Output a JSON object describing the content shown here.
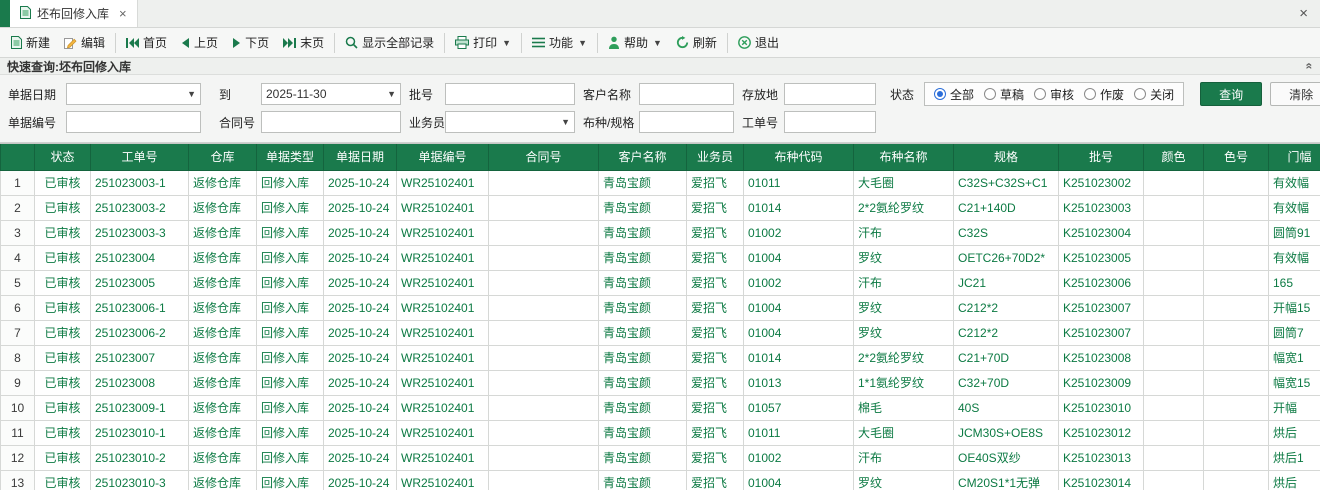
{
  "window": {
    "close_icon": "×"
  },
  "tab": {
    "label": "坯布回修入库",
    "close_icon": "×"
  },
  "toolbar": {
    "items": [
      {
        "name": "new",
        "label": "新建",
        "icon": "new-doc-icon"
      },
      {
        "name": "edit",
        "label": "编辑",
        "icon": "edit-icon"
      },
      {
        "type": "sep"
      },
      {
        "name": "first-page",
        "label": "首页",
        "icon": "first-page-icon"
      },
      {
        "name": "prev-page",
        "label": "上页",
        "icon": "prev-page-icon"
      },
      {
        "name": "next-page",
        "label": "下页",
        "icon": "next-page-icon"
      },
      {
        "name": "last-page",
        "label": "末页",
        "icon": "last-page-icon"
      },
      {
        "type": "sep"
      },
      {
        "name": "show-all-records",
        "label": "显示全部记录",
        "icon": "search-icon"
      },
      {
        "type": "sep"
      },
      {
        "name": "print",
        "label": "打印",
        "icon": "print-icon",
        "dropdown": true
      },
      {
        "type": "sep"
      },
      {
        "name": "functions",
        "label": "功能",
        "icon": "menu-icon",
        "dropdown": true
      },
      {
        "type": "sep"
      },
      {
        "name": "help",
        "label": "帮助",
        "icon": "person-icon",
        "dropdown": true
      },
      {
        "name": "refresh",
        "label": "刷新",
        "icon": "refresh-icon"
      },
      {
        "type": "sep"
      },
      {
        "name": "exit",
        "label": "退出",
        "icon": "exit-icon"
      }
    ]
  },
  "quickbar": {
    "label": "快速查询:坯布回修入库"
  },
  "filters": {
    "date_label": "单据日期",
    "date_from": "",
    "to_label": "到",
    "date_to": "2025-11-30",
    "batch_label": "批号",
    "batch_value": "",
    "customer_label": "客户名称",
    "customer_value": "",
    "location_label": "存放地",
    "location_value": "",
    "status_label": "状态",
    "status_options": [
      {
        "label": "全部",
        "selected": true
      },
      {
        "label": "草稿",
        "selected": false
      },
      {
        "label": "审核",
        "selected": false
      },
      {
        "label": "作废",
        "selected": false
      },
      {
        "label": "关闭",
        "selected": false
      }
    ],
    "query_button": "查询",
    "clear_button": "清除",
    "docno_label": "单据编号",
    "docno_value": "",
    "contract_label": "合同号",
    "contract_value": "",
    "salesman_label": "业务员",
    "salesman_value": "",
    "fabric_label": "布种/规格",
    "fabric_value": "",
    "workorder_label": "工单号",
    "workorder_value": ""
  },
  "table": {
    "columns": [
      "",
      "状态",
      "工单号",
      "仓库",
      "单据类型",
      "单据日期",
      "单据编号",
      "合同号",
      "客户名称",
      "业务员",
      "布种代码",
      "布种名称",
      "规格",
      "批号",
      "颜色",
      "色号",
      "门幅"
    ],
    "rows": [
      [
        "1",
        "已审核",
        "251023003-1",
        "返修仓库",
        "回修入库",
        "2025-10-24",
        "WR25102401",
        "",
        "青岛宝颜",
        "爱招飞",
        "01011",
        "大毛圈",
        "C32S+C32S+C1",
        "K251023002",
        "",
        "",
        "有效幅"
      ],
      [
        "2",
        "已审核",
        "251023003-2",
        "返修仓库",
        "回修入库",
        "2025-10-24",
        "WR25102401",
        "",
        "青岛宝颜",
        "爱招飞",
        "01014",
        "2*2氨纶罗纹",
        "C21+140D",
        "K251023003",
        "",
        "",
        "有效幅"
      ],
      [
        "3",
        "已审核",
        "251023003-3",
        "返修仓库",
        "回修入库",
        "2025-10-24",
        "WR25102401",
        "",
        "青岛宝颜",
        "爱招飞",
        "01002",
        "汗布",
        "C32S",
        "K251023004",
        "",
        "",
        "圆筒91"
      ],
      [
        "4",
        "已审核",
        "251023004",
        "返修仓库",
        "回修入库",
        "2025-10-24",
        "WR25102401",
        "",
        "青岛宝颜",
        "爱招飞",
        "01004",
        "罗纹",
        "OETC26+70D2*",
        "K251023005",
        "",
        "",
        "有效幅"
      ],
      [
        "5",
        "已审核",
        "251023005",
        "返修仓库",
        "回修入库",
        "2025-10-24",
        "WR25102401",
        "",
        "青岛宝颜",
        "爱招飞",
        "01002",
        "汗布",
        "JC21",
        "K251023006",
        "",
        "",
        "165"
      ],
      [
        "6",
        "已审核",
        "251023006-1",
        "返修仓库",
        "回修入库",
        "2025-10-24",
        "WR25102401",
        "",
        "青岛宝颜",
        "爱招飞",
        "01004",
        "罗纹",
        "C212*2",
        "K251023007",
        "",
        "",
        "开幅15"
      ],
      [
        "7",
        "已审核",
        "251023006-2",
        "返修仓库",
        "回修入库",
        "2025-10-24",
        "WR25102401",
        "",
        "青岛宝颜",
        "爱招飞",
        "01004",
        "罗纹",
        "C212*2",
        "K251023007",
        "",
        "",
        "圆筒7"
      ],
      [
        "8",
        "已审核",
        "251023007",
        "返修仓库",
        "回修入库",
        "2025-10-24",
        "WR25102401",
        "",
        "青岛宝颜",
        "爱招飞",
        "01014",
        "2*2氨纶罗纹",
        "C21+70D",
        "K251023008",
        "",
        "",
        "幅宽1"
      ],
      [
        "9",
        "已审核",
        "251023008",
        "返修仓库",
        "回修入库",
        "2025-10-24",
        "WR25102401",
        "",
        "青岛宝颜",
        "爱招飞",
        "01013",
        "1*1氨纶罗纹",
        "C32+70D",
        "K251023009",
        "",
        "",
        "幅宽15"
      ],
      [
        "10",
        "已审核",
        "251023009-1",
        "返修仓库",
        "回修入库",
        "2025-10-24",
        "WR25102401",
        "",
        "青岛宝颜",
        "爱招飞",
        "01057",
        "棉毛",
        "40S",
        "K251023010",
        "",
        "",
        "开幅"
      ],
      [
        "11",
        "已审核",
        "251023010-1",
        "返修仓库",
        "回修入库",
        "2025-10-24",
        "WR25102401",
        "",
        "青岛宝颜",
        "爱招飞",
        "01011",
        "大毛圈",
        "JCM30S+OE8S",
        "K251023012",
        "",
        "",
        "烘后"
      ],
      [
        "12",
        "已审核",
        "251023010-2",
        "返修仓库",
        "回修入库",
        "2025-10-24",
        "WR25102401",
        "",
        "青岛宝颜",
        "爱招飞",
        "01002",
        "汗布",
        "OE40S双纱",
        "K251023013",
        "",
        "",
        "烘后1"
      ],
      [
        "13",
        "已审核",
        "251023010-3",
        "返修仓库",
        "回修入库",
        "2025-10-24",
        "WR25102401",
        "",
        "青岛宝颜",
        "爱招飞",
        "01004",
        "罗纹",
        "CM20S1*1无弹",
        "K251023014",
        "",
        "",
        "烘后"
      ]
    ]
  },
  "colors": {
    "accent_green": "#1a7a4c",
    "cell_text_green": "#0c7a43",
    "radio_selected_blue": "#2a6dd9"
  }
}
